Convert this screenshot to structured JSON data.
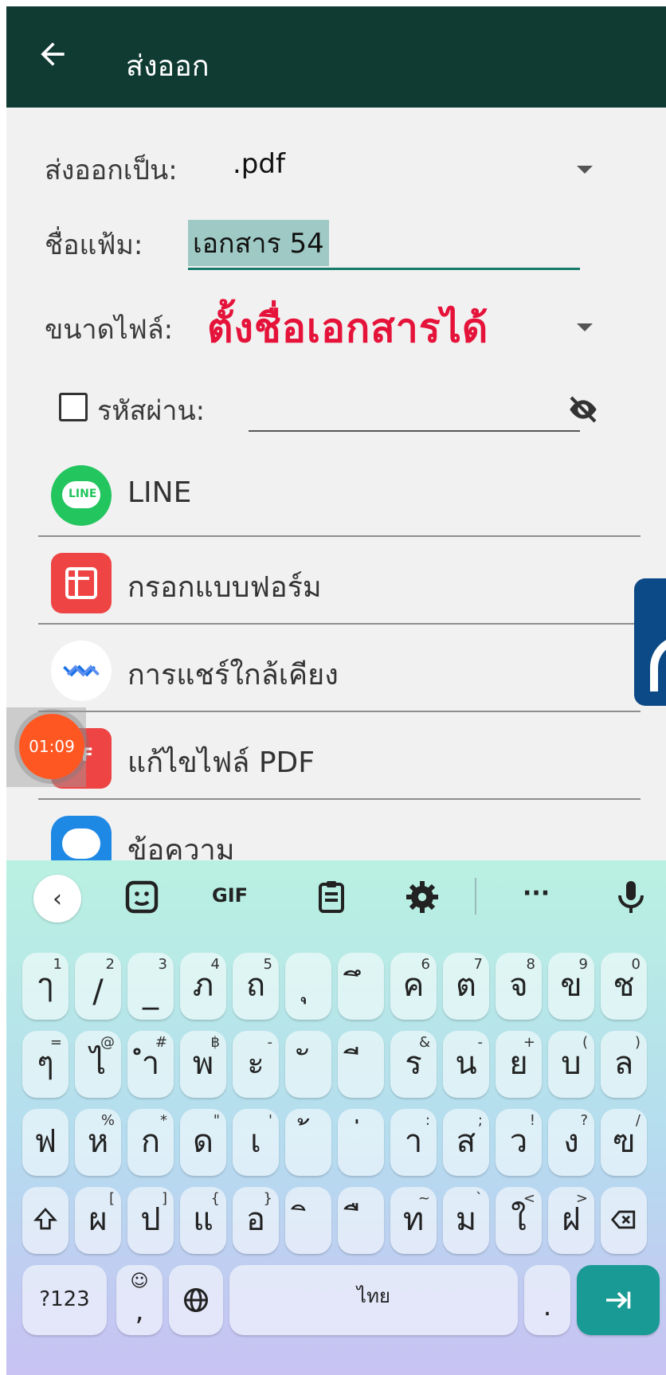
{
  "appbar": {
    "title": "ส่งออก"
  },
  "export_as": {
    "label": "ส่งออกเป็น:",
    "value": ".pdf"
  },
  "filename": {
    "label": "ชื่อแฟ้ม:",
    "value": "เอกสาร 54"
  },
  "file_size": {
    "label": "ขนาดไฟล์:"
  },
  "overlay": {
    "text": "ตั้งชื่อเอกสารได้"
  },
  "password": {
    "label": "รหัสผ่าน:"
  },
  "apps": [
    {
      "label": "LINE",
      "icon": "line-icon",
      "color": "#22c55e"
    },
    {
      "label": "กรอกแบบฟอร์ม",
      "icon": "form-fill-icon",
      "color": "#ef4444"
    },
    {
      "label": "การแชร์ใกล้เคียง",
      "icon": "nearby-share-icon",
      "color": "#1a73e8"
    },
    {
      "label": "แก้ไขไฟล์ PDF",
      "icon": "pdf-edit-icon",
      "color": "#ef4444"
    },
    {
      "label": "ข้อความ",
      "icon": "messages-icon",
      "color": "#1e88e5"
    }
  ],
  "timer": {
    "text": "01:09"
  },
  "keyboard": {
    "toolbar": {
      "gif": "GIF",
      "more": "···"
    },
    "row1": [
      {
        "m": "ๅ",
        "h": "1"
      },
      {
        "m": "/",
        "h": "2"
      },
      {
        "m": "_",
        "h": "3"
      },
      {
        "m": "ภ",
        "h": "4"
      },
      {
        "m": "ถ",
        "h": "5"
      },
      {
        "m": "ุ",
        "h": ""
      },
      {
        "m": "ึ",
        "h": ""
      },
      {
        "m": "ค",
        "h": "6"
      },
      {
        "m": "ต",
        "h": "7"
      },
      {
        "m": "จ",
        "h": "8"
      },
      {
        "m": "ข",
        "h": "9"
      },
      {
        "m": "ช",
        "h": "0"
      }
    ],
    "row2": [
      {
        "m": "ๆ",
        "h": "="
      },
      {
        "m": "ไ",
        "h": "@"
      },
      {
        "m": "ำ",
        "h": "#"
      },
      {
        "m": "พ",
        "h": "฿"
      },
      {
        "m": "ะ",
        "h": "-"
      },
      {
        "m": "ั",
        "h": ""
      },
      {
        "m": "ี",
        "h": ""
      },
      {
        "m": "ร",
        "h": "&"
      },
      {
        "m": "น",
        "h": "-"
      },
      {
        "m": "ย",
        "h": "+"
      },
      {
        "m": "บ",
        "h": "("
      },
      {
        "m": "ล",
        "h": ")"
      }
    ],
    "row3": [
      {
        "m": "ฟ",
        "h": ""
      },
      {
        "m": "ห",
        "h": "%"
      },
      {
        "m": "ก",
        "h": "*"
      },
      {
        "m": "ด",
        "h": "\""
      },
      {
        "m": "เ",
        "h": "'"
      },
      {
        "m": "้",
        "h": ""
      },
      {
        "m": "่",
        "h": ""
      },
      {
        "m": "า",
        "h": ":"
      },
      {
        "m": "ส",
        "h": ";"
      },
      {
        "m": "ว",
        "h": "!"
      },
      {
        "m": "ง",
        "h": "?"
      },
      {
        "m": "ฃ",
        "h": "/"
      }
    ],
    "row4": [
      {
        "m": "ผ",
        "h": "["
      },
      {
        "m": "ป",
        "h": "]"
      },
      {
        "m": "แ",
        "h": "{"
      },
      {
        "m": "อ",
        "h": "}"
      },
      {
        "m": "ิ",
        "h": ""
      },
      {
        "m": "ื",
        "h": ""
      },
      {
        "m": "ท",
        "h": "~"
      },
      {
        "m": "ม",
        "h": "`"
      },
      {
        "m": "ใ",
        "h": "<"
      },
      {
        "m": "ฝ",
        "h": ">"
      }
    ],
    "bottom": {
      "sym": "?123",
      "comma": ",",
      "space": "ไทย",
      "period": "."
    }
  }
}
